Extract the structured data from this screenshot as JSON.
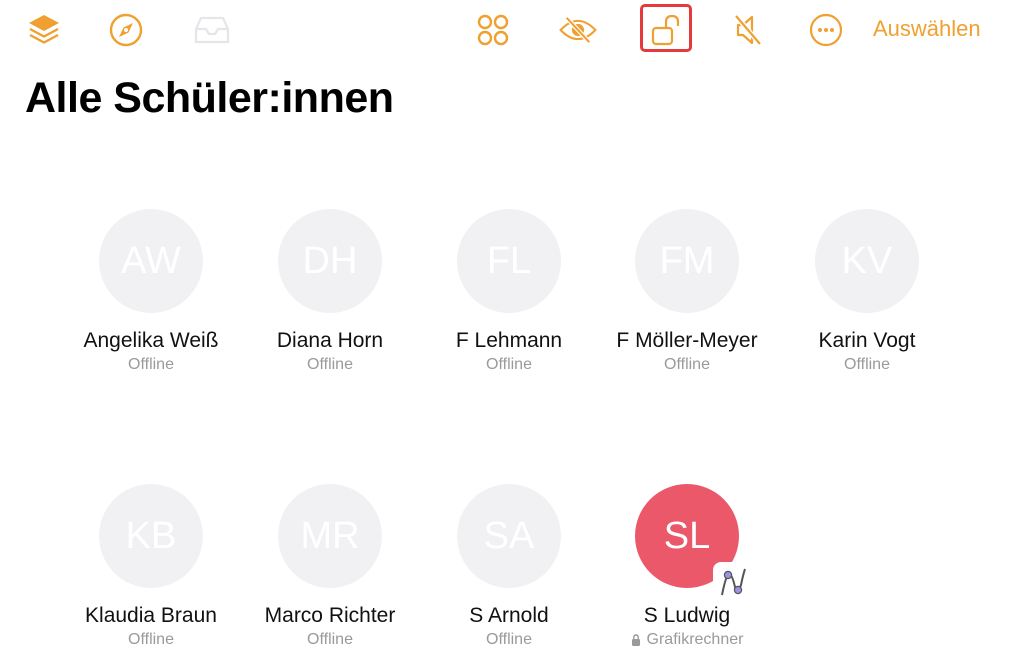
{
  "toolbar": {
    "icons": [
      {
        "name": "layers-icon",
        "color": "#f0a030"
      },
      {
        "name": "compass-icon",
        "color": "#f0a030"
      },
      {
        "name": "inbox-icon",
        "color": "#e6e6ea"
      },
      {
        "name": "apps-grid-icon",
        "color": "#f0a030"
      },
      {
        "name": "eye-slash-icon",
        "color": "#f0a030"
      },
      {
        "name": "unlock-icon",
        "color": "#f0a030"
      },
      {
        "name": "speaker-mute-icon",
        "color": "#f0a030"
      },
      {
        "name": "more-icon",
        "color": "#f0a030"
      }
    ],
    "select_label": "Auswählen",
    "accent": "#f0a030"
  },
  "page": {
    "title": "Alle Schüler:innen"
  },
  "students": [
    {
      "initials": "AW",
      "name": "Angelika Weiß",
      "status": "Offline"
    },
    {
      "initials": "DH",
      "name": "Diana Horn",
      "status": "Offline"
    },
    {
      "initials": "FL",
      "name": "F Lehmann",
      "status": "Offline"
    },
    {
      "initials": "FM",
      "name": "F Möller-Meyer",
      "status": "Offline"
    },
    {
      "initials": "KV",
      "name": "Karin Vogt",
      "status": "Offline"
    },
    {
      "initials": "KB",
      "name": "Klaudia Braun",
      "status": "Offline"
    },
    {
      "initials": "MR",
      "name": "Marco Richter",
      "status": "Offline"
    },
    {
      "initials": "SA",
      "name": "S Arnold",
      "status": "Offline"
    },
    {
      "initials": "SL",
      "name": "S Ludwig",
      "status": "Grafikrechner",
      "active": true,
      "avatar_color": "#ea5869",
      "app_badge": "grapher-app-icon",
      "locked": true
    }
  ]
}
